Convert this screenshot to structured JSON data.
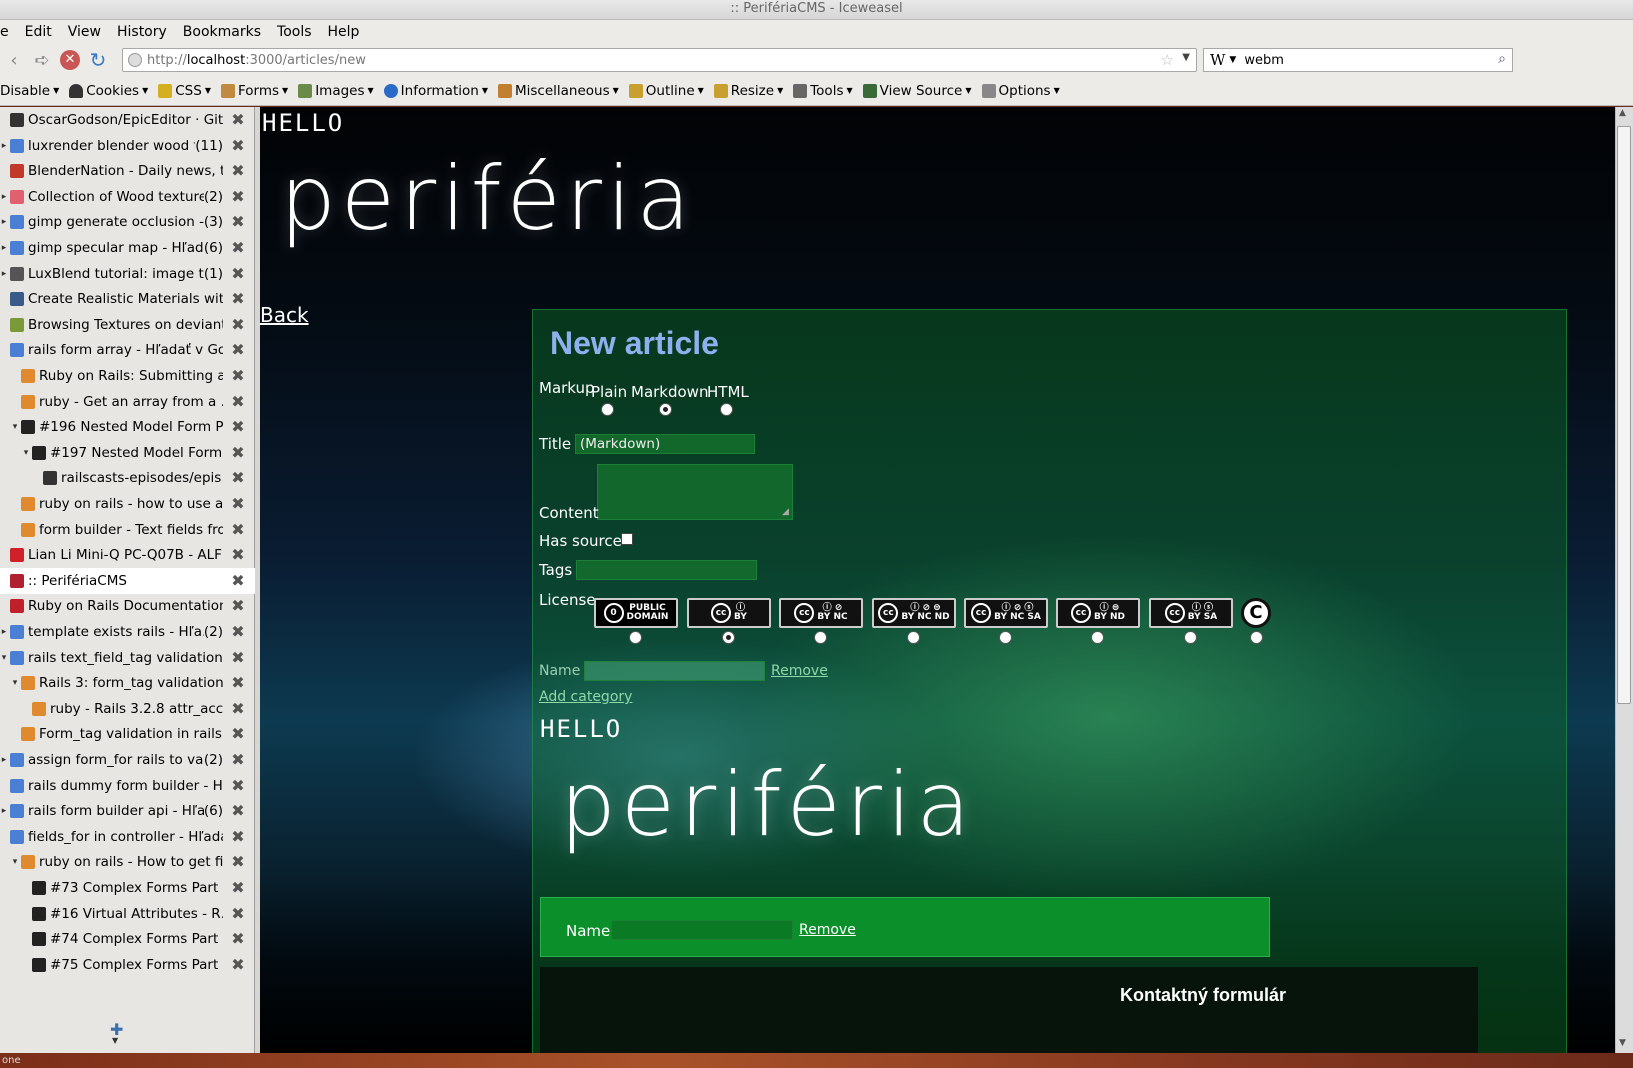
{
  "window": {
    "title": ":: PerifériaCMS - Iceweasel"
  },
  "menubar": {
    "items": [
      "e",
      "Edit",
      "View",
      "History",
      "Bookmarks",
      "Tools",
      "Help"
    ]
  },
  "navbar": {
    "url_prefix": "http://",
    "url_host": "localhost",
    "url_rest": ":3000/articles/new",
    "search_engine_glyph": "W",
    "search_value": "webm"
  },
  "devbar": {
    "items": [
      "Disable",
      "Cookies",
      "CSS",
      "Forms",
      "Images",
      "Information",
      "Miscellaneous",
      "Outline",
      "Resize",
      "Tools",
      "View Source",
      "Options"
    ]
  },
  "sidebar": {
    "tabs": [
      {
        "title": "OscarGodson/EpicEditor · Git…",
        "count": "",
        "indent": 0,
        "twisty": "",
        "favicon_color": "#333333",
        "active": false
      },
      {
        "title": "luxrender blender wood fl…",
        "count": "(11)",
        "indent": 0,
        "twisty": "▸",
        "favicon_color": "#4a7fd4",
        "active": false
      },
      {
        "title": "BlenderNation - Daily news, t…",
        "count": "",
        "indent": 0,
        "twisty": "",
        "favicon_color": "#c0392b",
        "active": false
      },
      {
        "title": "Collection of Wood texture…",
        "count": "(2)",
        "indent": 0,
        "twisty": "▸",
        "favicon_color": "#e06070",
        "active": false
      },
      {
        "title": "gimp generate occlusion - …",
        "count": "(3)",
        "indent": 0,
        "twisty": "▸",
        "favicon_color": "#4a7fd4",
        "active": false
      },
      {
        "title": "gimp specular map - Hľad…",
        "count": "(6)",
        "indent": 0,
        "twisty": "▸",
        "favicon_color": "#4a7fd4",
        "active": false
      },
      {
        "title": "LuxBlend tutorial: image t…",
        "count": "(1)",
        "indent": 0,
        "twisty": "▸",
        "favicon_color": "#555555",
        "active": false
      },
      {
        "title": "Create Realistic Materials wit…",
        "count": "",
        "indent": 0,
        "twisty": "",
        "favicon_color": "#3a5a8a",
        "active": false
      },
      {
        "title": "Browsing Textures on deviant…",
        "count": "",
        "indent": 0,
        "twisty": "",
        "favicon_color": "#7a9a3a",
        "active": false
      },
      {
        "title": "rails form array - Hľadať v Go…",
        "count": "",
        "indent": 0,
        "twisty": "",
        "favicon_color": "#4a7fd4",
        "active": false
      },
      {
        "title": "Ruby on Rails: Submitting a…",
        "count": "",
        "indent": 1,
        "twisty": "",
        "favicon_color": "#e08a30",
        "active": false
      },
      {
        "title": "ruby - Get an array from a …",
        "count": "",
        "indent": 1,
        "twisty": "",
        "favicon_color": "#e08a30",
        "active": false
      },
      {
        "title": "#196 Nested Model Form P…",
        "count": "",
        "indent": 1,
        "twisty": "▾",
        "favicon_color": "#222222",
        "active": false
      },
      {
        "title": "#197 Nested Model Form…",
        "count": "",
        "indent": 2,
        "twisty": "▾",
        "favicon_color": "#222222",
        "active": false
      },
      {
        "title": "railscasts-episodes/epis…",
        "count": "",
        "indent": 3,
        "twisty": "",
        "favicon_color": "#333333",
        "active": false
      },
      {
        "title": "ruby on rails - how to use a…",
        "count": "",
        "indent": 1,
        "twisty": "",
        "favicon_color": "#e08a30",
        "active": false
      },
      {
        "title": "form builder - Text fields fro…",
        "count": "",
        "indent": 1,
        "twisty": "",
        "favicon_color": "#e08a30",
        "active": false
      },
      {
        "title": "Lian Li Mini-Q PC-Q07B - ALF…",
        "count": "",
        "indent": 0,
        "twisty": "",
        "favicon_color": "#d0202a",
        "active": false
      },
      {
        "title": ":: PerifériaCMS",
        "count": "",
        "indent": 0,
        "twisty": "",
        "favicon_color": "#b02030",
        "active": true
      },
      {
        "title": "Ruby on Rails Documentation",
        "count": "",
        "indent": 0,
        "twisty": "",
        "favicon_color": "#c0202a",
        "active": false
      },
      {
        "title": "template exists rails - Hľa…",
        "count": "(2)",
        "indent": 0,
        "twisty": "▸",
        "favicon_color": "#4a7fd4",
        "active": false
      },
      {
        "title": "rails text_field_tag validation …",
        "count": "",
        "indent": 0,
        "twisty": "▾",
        "favicon_color": "#4a7fd4",
        "active": false
      },
      {
        "title": "Rails 3: form_tag validation …",
        "count": "",
        "indent": 1,
        "twisty": "▾",
        "favicon_color": "#e08a30",
        "active": false
      },
      {
        "title": "ruby - Rails 3.2.8 attr_acc…",
        "count": "",
        "indent": 2,
        "twisty": "",
        "favicon_color": "#e08a30",
        "active": false
      },
      {
        "title": "Form_tag validation in rails …",
        "count": "",
        "indent": 1,
        "twisty": "",
        "favicon_color": "#e08a30",
        "active": false
      },
      {
        "title": "assign form_for rails to var…",
        "count": "(2)",
        "indent": 0,
        "twisty": "▸",
        "favicon_color": "#4a7fd4",
        "active": false
      },
      {
        "title": "rails dummy form builder - Hľ…",
        "count": "",
        "indent": 0,
        "twisty": "",
        "favicon_color": "#4a7fd4",
        "active": false
      },
      {
        "title": "rails form builder api - Hľa…",
        "count": "(6)",
        "indent": 0,
        "twisty": "▸",
        "favicon_color": "#4a7fd4",
        "active": false
      },
      {
        "title": "fields_for in controller - Hľada…",
        "count": "",
        "indent": 0,
        "twisty": "",
        "favicon_color": "#4a7fd4",
        "active": false
      },
      {
        "title": "ruby on rails - How to get fi…",
        "count": "",
        "indent": 1,
        "twisty": "▾",
        "favicon_color": "#e08a30",
        "active": false
      },
      {
        "title": "#73 Complex Forms Part …",
        "count": "",
        "indent": 2,
        "twisty": "",
        "favicon_color": "#222222",
        "active": false
      },
      {
        "title": "#16 Virtual Attributes - R…",
        "count": "",
        "indent": 2,
        "twisty": "",
        "favicon_color": "#222222",
        "active": false
      },
      {
        "title": "#74 Complex Forms Part …",
        "count": "",
        "indent": 2,
        "twisty": "",
        "favicon_color": "#222222",
        "active": false
      },
      {
        "title": "#75 Complex Forms Part …",
        "count": "",
        "indent": 2,
        "twisty": "",
        "favicon_color": "#222222",
        "active": false
      }
    ]
  },
  "page": {
    "hello": "HELLO",
    "brand": "periféria",
    "back": "Back",
    "heading": "New article",
    "markup_label": "Markup",
    "markup_options": [
      "Plain",
      "Markdown",
      "HTML"
    ],
    "markup_selected": 1,
    "title_label": "Title",
    "title_value": "(Markdown)",
    "content_label": "Content",
    "content_value": "",
    "has_source_label": "Has source",
    "tags_label": "Tags",
    "tags_value": "",
    "license_label": "License",
    "licenses": [
      {
        "top": "PUBLIC",
        "bottom": "DOMAIN"
      },
      {
        "top": "ⓘ",
        "bottom": "BY"
      },
      {
        "top": "ⓘ ⊘",
        "bottom": "BY NC"
      },
      {
        "top": "ⓘ ⊘ ⊜",
        "bottom": "BY NC ND"
      },
      {
        "top": "ⓘ ⊘ ⓢ",
        "bottom": "BY NC SA"
      },
      {
        "top": "ⓘ ⊜",
        "bottom": "BY ND"
      },
      {
        "top": "ⓘ ⓢ",
        "bottom": "BY SA"
      }
    ],
    "license_copyright": "C",
    "license_selected": 1,
    "name_label": "Name",
    "remove_label": "Remove",
    "add_category": "Add category",
    "hello2": "HELLO",
    "brand2": "periféria",
    "name2_label": "Name",
    "remove2_label": "Remove",
    "footer_heading": "Kontaktný formulár"
  },
  "statusbar": {
    "text": "one"
  },
  "colors": {
    "heading": "#8fb0ee",
    "panel": "#0a6e28",
    "link": "#8fd8a8"
  }
}
